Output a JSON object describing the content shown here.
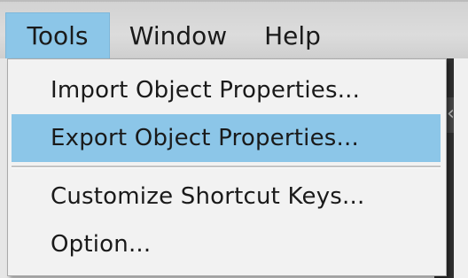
{
  "menubar": {
    "menus": [
      {
        "label": "Tools",
        "active": true
      },
      {
        "label": "Window",
        "active": false
      },
      {
        "label": "Help",
        "active": false
      }
    ]
  },
  "dropdown": {
    "items": [
      {
        "label": "Import Object Properties...",
        "highlighted": false
      },
      {
        "label": "Export Object Properties...",
        "highlighted": true
      },
      {
        "label": "Customize Shortcut Keys...",
        "highlighted": false
      },
      {
        "label": "Option...",
        "highlighted": false
      }
    ]
  },
  "icons": {
    "scroll_knob": "scroll-arrows-icon"
  },
  "colors": {
    "highlight": "#8cc6e8",
    "menu_background": "#f2f2f2",
    "menubar_background": "#d8d8d8",
    "text": "#1a1a1a"
  }
}
